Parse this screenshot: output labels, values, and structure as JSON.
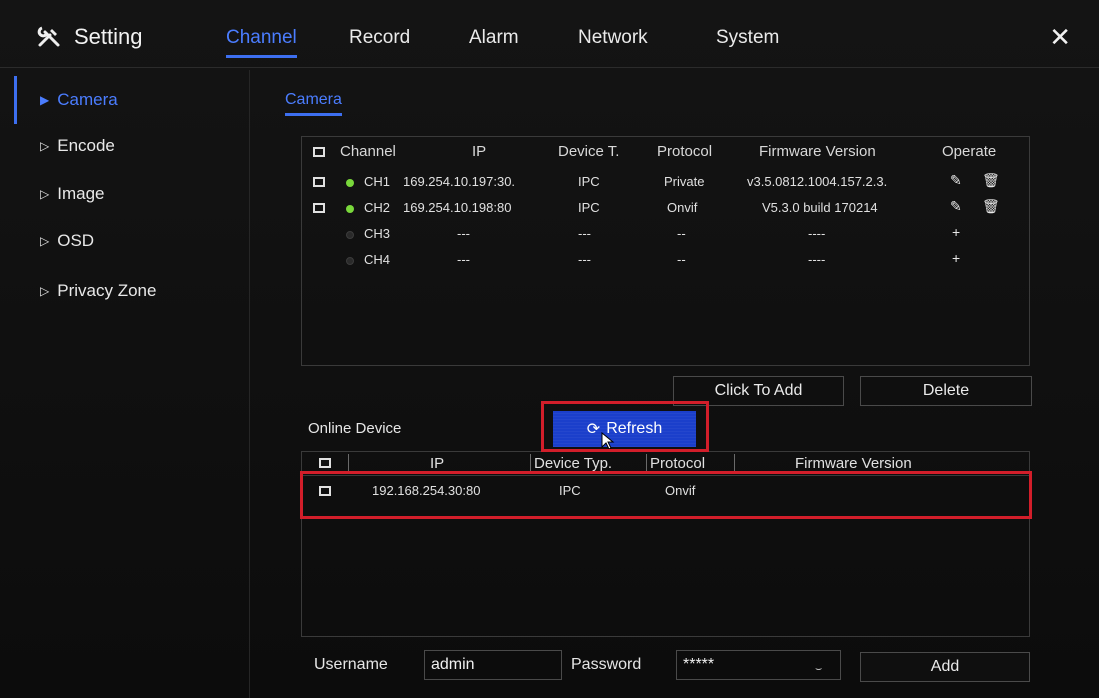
{
  "header": {
    "title": "Setting",
    "tabs": [
      "Channel",
      "Record",
      "Alarm",
      "Network",
      "System"
    ],
    "active_tab": "Channel",
    "close_icon": "close-icon"
  },
  "sidebar": {
    "items": [
      "Camera",
      "Encode",
      "Image",
      "OSD",
      "Privacy Zone"
    ],
    "active": "Camera"
  },
  "subtab": "Camera",
  "camera_table": {
    "headers": [
      "Channel",
      "IP",
      "Device T.",
      "Protocol",
      "Firmware Version",
      "Operate"
    ],
    "rows": [
      {
        "channel": "CH1",
        "status": "online",
        "ip": "169.254.10.197:30.",
        "device": "IPC",
        "protocol": "Private",
        "firmware": "v3.5.0812.1004.157.2.3.",
        "edit_icon": "edit-icon",
        "delete_icon": "trash-icon"
      },
      {
        "channel": "CH2",
        "status": "online",
        "ip": "169.254.10.198:80",
        "device": "IPC",
        "protocol": "Onvif",
        "firmware": "V5.3.0 build 170214",
        "edit_icon": "edit-icon",
        "delete_icon": "trash-icon"
      },
      {
        "channel": "CH3",
        "status": "offline",
        "ip": "---",
        "device": "---",
        "protocol": "--",
        "firmware": "----",
        "add_icon": "plus-icon"
      },
      {
        "channel": "CH4",
        "status": "offline",
        "ip": "---",
        "device": "---",
        "protocol": "--",
        "firmware": "----",
        "add_icon": "plus-icon"
      }
    ]
  },
  "buttons": {
    "click_to_add": "Click To Add",
    "delete": "Delete",
    "refresh": "Refresh",
    "add": "Add"
  },
  "online_device": {
    "label": "Online Device",
    "headers": [
      "IP",
      "Device Typ.",
      "Protocol",
      "Firmware Version"
    ],
    "rows": [
      {
        "ip": "192.168.254.30:80",
        "device": "IPC",
        "protocol": "Onvif",
        "firmware": ""
      }
    ]
  },
  "form": {
    "username_label": "Username",
    "username_value": "admin",
    "password_label": "Password",
    "password_value": "*****"
  },
  "colors": {
    "accent": "#3d6ff0",
    "refresh_bg": "#1b3fcb",
    "highlight": "#d21e2a",
    "status_online": "#79d83b"
  }
}
